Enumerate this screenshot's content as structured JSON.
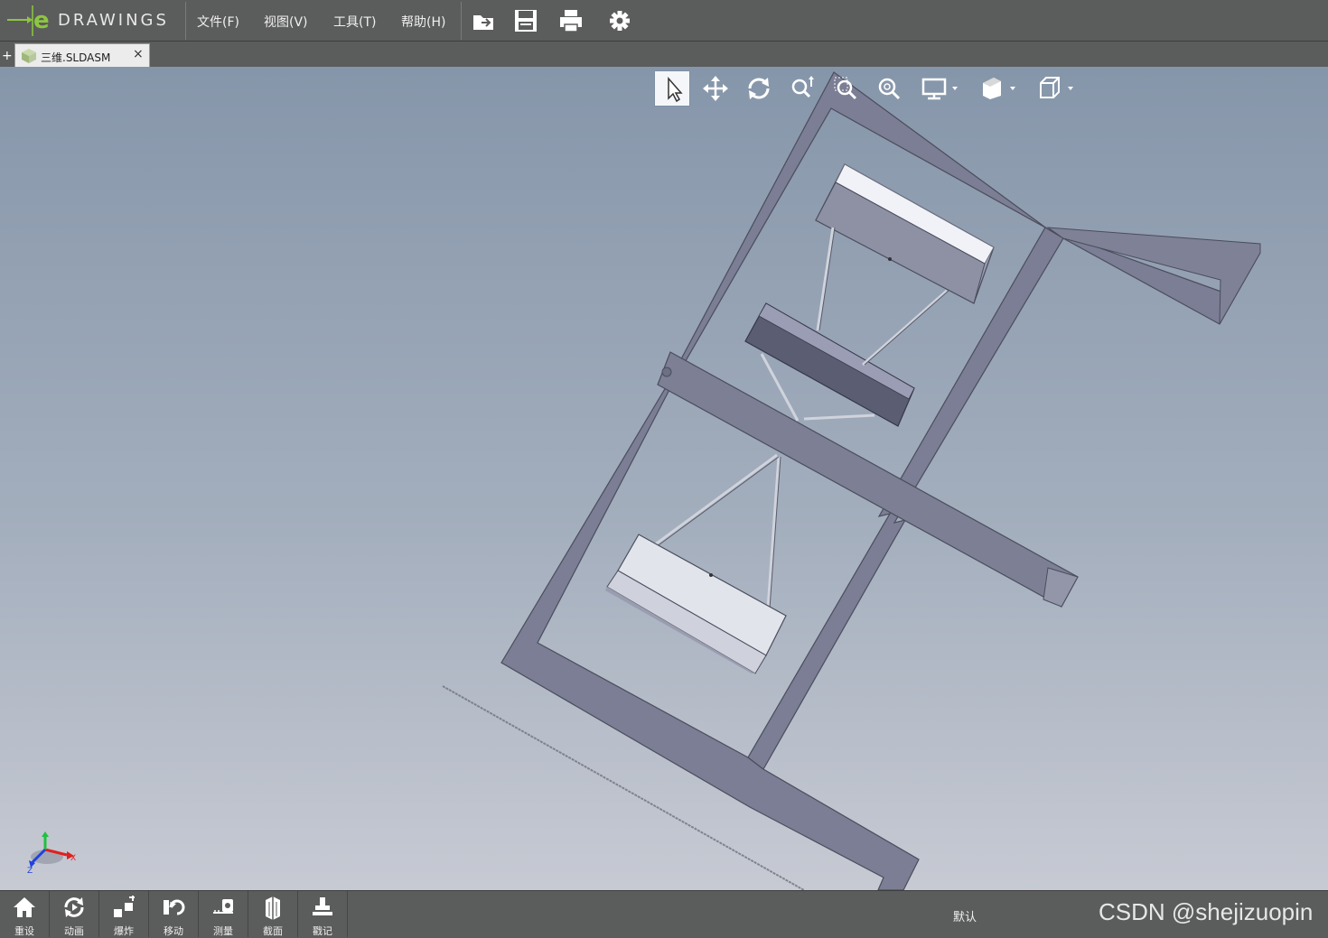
{
  "app": {
    "brand": "DRAWINGS",
    "brand_prefix": "e"
  },
  "menu": {
    "file": "文件(F)",
    "view": "视图(V)",
    "tools": "工具(T)",
    "help": "帮助(H)"
  },
  "toolbar_icons": [
    "open-icon",
    "save-icon",
    "print-icon",
    "settings-icon"
  ],
  "tab": {
    "label": "三维.SLDASM",
    "close": "×",
    "new_tab": "+"
  },
  "view_toolbar_icons": [
    "select-icon",
    "pan-icon",
    "rotate-icon",
    "zoom-to-fit-icon",
    "zoom-to-area-icon",
    "zoom-in-out-icon",
    "display-style-icon",
    "shading-icon",
    "standard-views-icon"
  ],
  "triad": {
    "x_label": "X",
    "z_label": "Z"
  },
  "statusbar": {
    "buttons": [
      {
        "label": "重设",
        "icon": "home-icon"
      },
      {
        "label": "动画",
        "icon": "animate-icon"
      },
      {
        "label": "爆炸",
        "icon": "explode-icon"
      },
      {
        "label": "移动",
        "icon": "move-icon"
      },
      {
        "label": "测量",
        "icon": "measure-icon"
      },
      {
        "label": "截面",
        "icon": "section-icon"
      },
      {
        "label": "戳记",
        "icon": "stamp-icon"
      }
    ],
    "configuration": "默认",
    "watermark": "CSDN @shejizuopin"
  },
  "colors": {
    "brand_green": "#8dc63f",
    "chrome": "#5b5c5c",
    "frame": "#7a7d92"
  }
}
